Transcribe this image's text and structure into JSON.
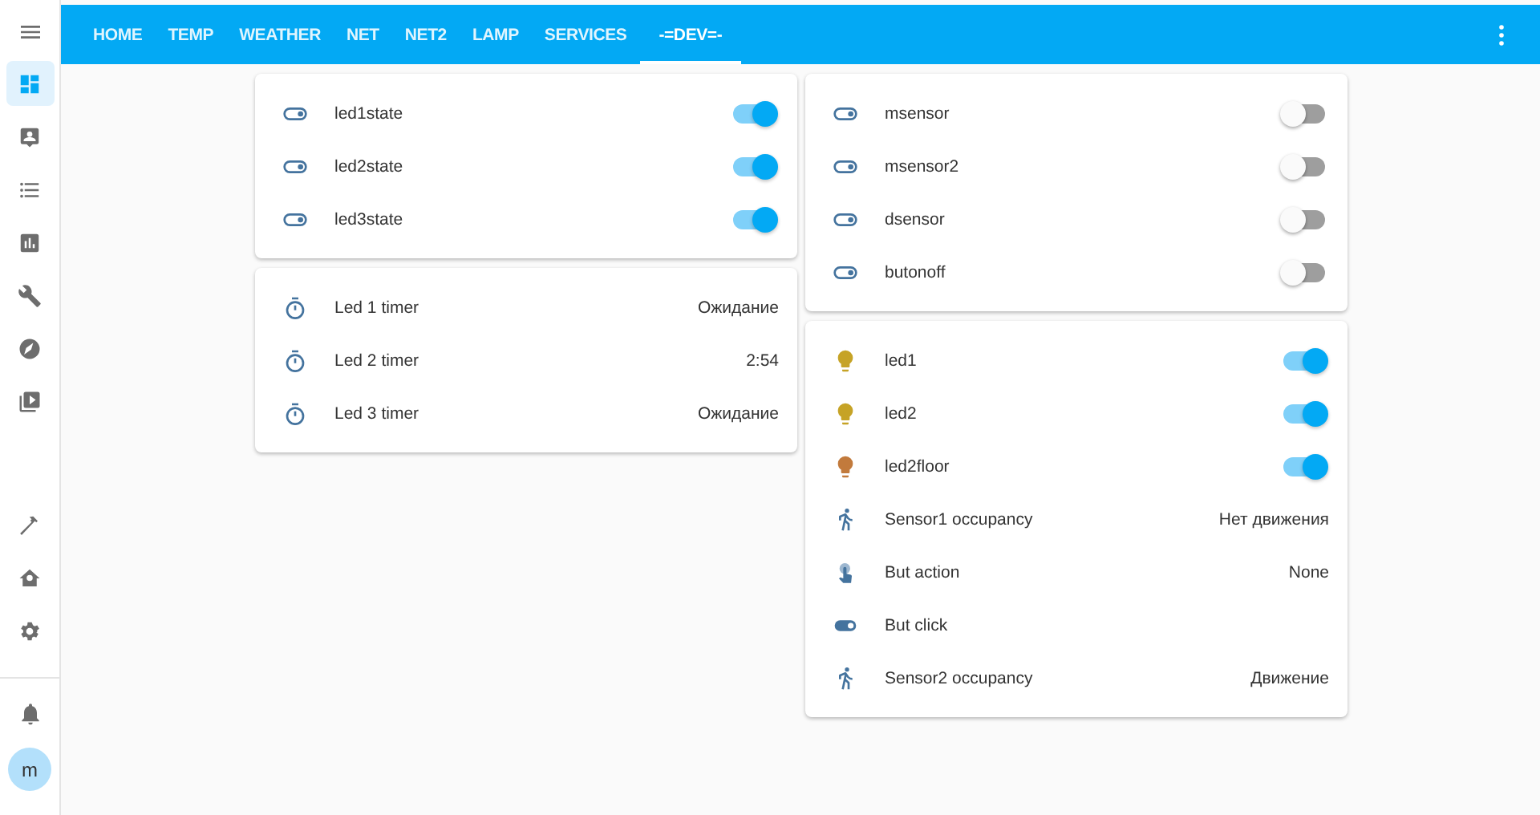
{
  "sidebar": {
    "items": [
      {
        "selected": true
      },
      {
        "selected": false
      },
      {
        "selected": false
      },
      {
        "selected": false
      },
      {
        "selected": false
      },
      {
        "selected": false
      },
      {
        "selected": false
      },
      {
        "selected": false
      },
      {
        "selected": false
      },
      {
        "selected": false
      }
    ],
    "avatar": "m"
  },
  "tabs": [
    {
      "label": "HOME",
      "selected": false
    },
    {
      "label": "TEMP",
      "selected": false
    },
    {
      "label": "WEATHER",
      "selected": false
    },
    {
      "label": "NET",
      "selected": false
    },
    {
      "label": "NET2",
      "selected": false
    },
    {
      "label": "LAMP",
      "selected": false
    },
    {
      "label": "SERVICES",
      "selected": false
    },
    {
      "label": "-=DEV=-",
      "selected": true
    }
  ],
  "columns": [
    [
      {
        "rows": [
          {
            "kind": "switch",
            "name": "led1state",
            "on": true
          },
          {
            "kind": "switch",
            "name": "led2state",
            "on": true
          },
          {
            "kind": "switch",
            "name": "led3state",
            "on": true
          }
        ]
      },
      {
        "rows": [
          {
            "kind": "timer",
            "name": "Led 1 timer",
            "value": "Ожидание"
          },
          {
            "kind": "timer",
            "name": "Led 2 timer",
            "value": "2:54"
          },
          {
            "kind": "timer",
            "name": "Led 3 timer",
            "value": "Ожидание"
          }
        ]
      }
    ],
    [
      {
        "rows": [
          {
            "kind": "switch",
            "name": "msensor",
            "on": false
          },
          {
            "kind": "switch",
            "name": "msensor2",
            "on": false
          },
          {
            "kind": "switch",
            "name": "dsensor",
            "on": false
          },
          {
            "kind": "switch",
            "name": "butonoff",
            "on": false
          }
        ]
      },
      {
        "rows": [
          {
            "kind": "light",
            "name": "led1",
            "on": true,
            "color": "#c6a326"
          },
          {
            "kind": "light",
            "name": "led2",
            "on": true,
            "color": "#c6a326"
          },
          {
            "kind": "light",
            "name": "led2floor",
            "on": true,
            "color": "#c27a3c"
          },
          {
            "kind": "motion",
            "name": "Sensor1 occupancy",
            "value": "Нет движения"
          },
          {
            "kind": "touch",
            "name": "But action",
            "value": "None"
          },
          {
            "kind": "button",
            "name": "But click"
          },
          {
            "kind": "motion",
            "name": "Sensor2 occupancy",
            "value": "Движение"
          }
        ]
      }
    ]
  ]
}
